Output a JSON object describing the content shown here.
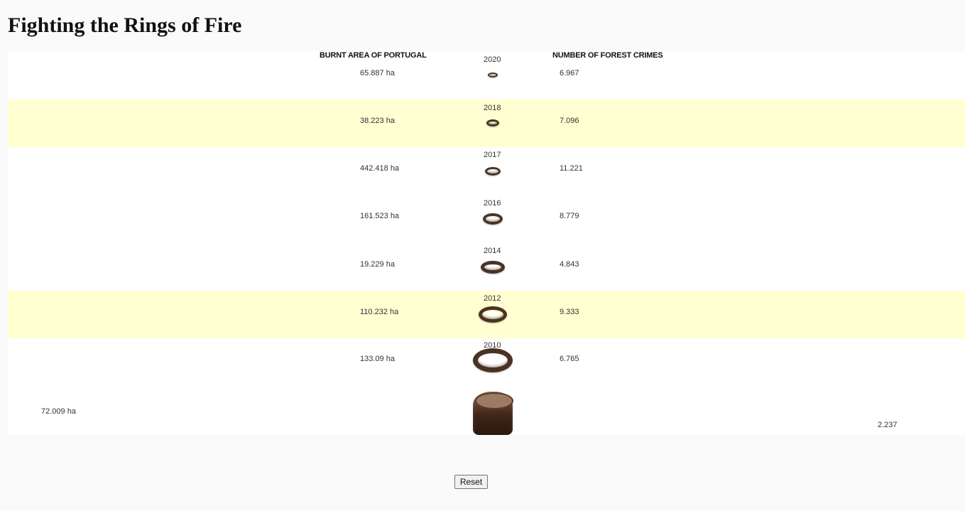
{
  "page": {
    "title": "Fighting the Rings of Fire"
  },
  "columns": {
    "burnt_area": "BURNT AREA OF PORTUGAL",
    "forest_crimes": "NUMBER OF FOREST CRIMES"
  },
  "rows": [
    {
      "year": "2020",
      "area": "65.887 ha",
      "crimes": "6.967",
      "highlighted": false
    },
    {
      "year": "2018",
      "area": "38.223 ha",
      "crimes": "7.096",
      "highlighted": true
    },
    {
      "year": "2017",
      "area": "442.418 ha",
      "crimes": "11.221",
      "highlighted": false
    },
    {
      "year": "2016",
      "area": "161.523 ha",
      "crimes": "8.779",
      "highlighted": false
    },
    {
      "year": "2014",
      "area": "19.229 ha",
      "crimes": "4.843",
      "highlighted": false
    },
    {
      "year": "2012",
      "area": "110.232 ha",
      "crimes": "9.333",
      "highlighted": true
    },
    {
      "year": "2010",
      "area": "133.09 ha",
      "crimes": "6.765",
      "highlighted": false
    }
  ],
  "extra": {
    "area": "72.009 ha",
    "crimes": "2.237"
  },
  "controls": {
    "reset_label": "Reset"
  },
  "colors": {
    "highlight": "#ffffd2",
    "ring": "#4b3223"
  }
}
